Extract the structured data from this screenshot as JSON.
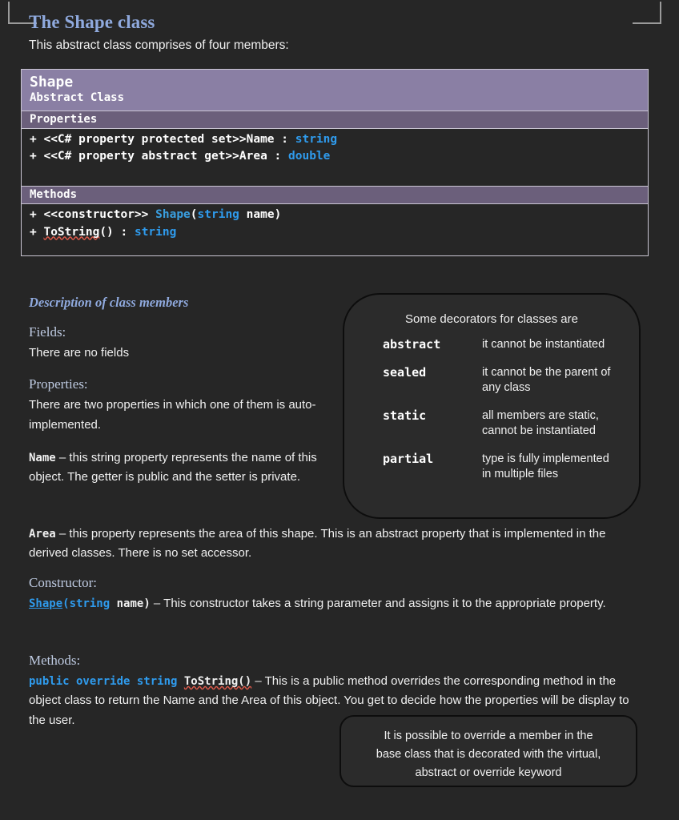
{
  "page": {
    "title": "The Shape class",
    "intro": "This abstract class comprises of four members:"
  },
  "uml": {
    "class_name": "Shape",
    "stereotype": "Abstract Class",
    "properties_header": "Properties",
    "methods_header": "Methods",
    "properties": [
      {
        "visibility": "+",
        "signature": "+ <<C# property protected set>>Name : ",
        "type": "string"
      },
      {
        "visibility": "+",
        "signature": "+ <<C# property abstract get>>Area : ",
        "type": "double"
      }
    ],
    "methods": [
      {
        "prefix": "+ <<constructor>> ",
        "name": "Shape",
        "open_paren": "(",
        "param_type": "string",
        "param_rest": " name)"
      },
      {
        "prefix": "+ ",
        "name": "ToString",
        "middle": "() : ",
        "type": "string"
      }
    ]
  },
  "description": {
    "title": "Description of class members",
    "fields_head": "Fields:",
    "fields_text": "There are no fields",
    "properties_head": "Properties:",
    "properties_text": "There are two properties in which one of them is auto-implemented.",
    "name_label": "Name",
    "name_text": " – this string property represents the name of this object. The getter is public and the setter is private.",
    "area_label": "Area",
    "area_text": " – this property represents the area of this shape. This is an abstract property that is implemented in the derived classes. There is no set accessor.",
    "constructor_head": "Constructor:",
    "ctor_name": "Shape",
    "ctor_open": "(",
    "ctor_type": "string",
    "ctor_param": " name)",
    "ctor_text": " – This constructor takes a string parameter and assigns it to the appropriate property.",
    "methods_head": "Methods:",
    "method_modifiers": "public override string ",
    "method_name": "ToString()",
    "method_text": " – This is a public method overrides the corresponding method in the object class to return the Name and the Area of this object. You get to decide how the properties will be display to the user."
  },
  "callout_decorators": {
    "heading": "Some decorators for classes are",
    "rows": [
      {
        "keyword": "abstract",
        "desc": "it cannot be instantiated"
      },
      {
        "keyword": "sealed",
        "desc": "it cannot be the parent of any class"
      },
      {
        "keyword": "static",
        "desc": "all members are static, cannot be instantiated"
      },
      {
        "keyword": "partial",
        "desc": "type is fully implemented in multiple files"
      }
    ]
  },
  "callout_override": {
    "line1": "It is possible to override a member in the",
    "line2": "base class that is decorated with the virtual,",
    "line3": "abstract or override keyword"
  },
  "colors": {
    "background": "#262626",
    "heading_blue": "#8fa9dd",
    "code_blue": "#2f9bed",
    "uml_title_band": "#8a7fa4",
    "uml_section_band": "#6b5f7b",
    "uml_border": "#c9c5d2",
    "subhead_blue": "#bfcbe2",
    "squiggle_red": "#e05a4a"
  }
}
